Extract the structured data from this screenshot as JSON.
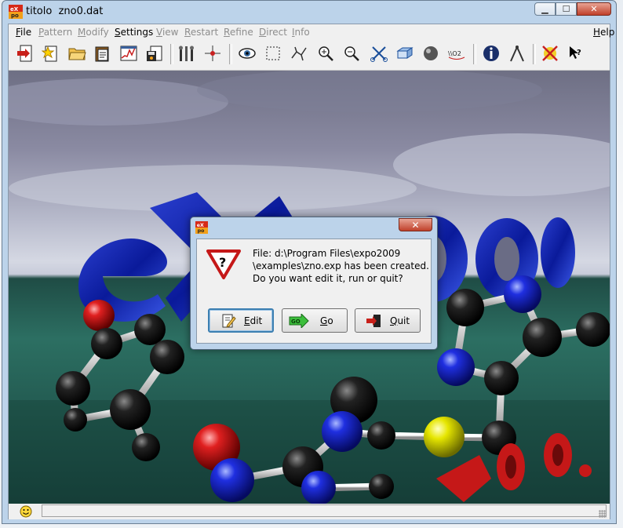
{
  "window": {
    "title": "titolo  zno0.dat",
    "controls": {
      "minimize": "▁",
      "maximize": "☐",
      "close": "✕"
    }
  },
  "menu": [
    {
      "label": "File",
      "enabled": true
    },
    {
      "label": "Pattern",
      "enabled": false
    },
    {
      "label": "Modify",
      "enabled": false
    },
    {
      "label": "Settings",
      "enabled": true
    },
    {
      "label": "View",
      "enabled": false
    },
    {
      "label": "Restart",
      "enabled": false
    },
    {
      "label": "Refine",
      "enabled": false
    },
    {
      "label": "Direct",
      "enabled": false
    },
    {
      "label": "Info",
      "enabled": false
    },
    {
      "label": "Help",
      "enabled": true
    }
  ],
  "toolbar": [
    {
      "icon": "open-file-icon"
    },
    {
      "icon": "new-file-icon"
    },
    {
      "icon": "folder-icon"
    },
    {
      "icon": "clipboard-icon"
    },
    {
      "icon": "pattern-chart-icon"
    },
    {
      "icon": "save-disk-icon"
    },
    {
      "icon": "tools-icon"
    },
    {
      "icon": "crosshair-icon"
    },
    {
      "icon": "eye-icon"
    },
    {
      "icon": "selection-icon"
    },
    {
      "icon": "molecule-icon"
    },
    {
      "icon": "zoom-in-icon"
    },
    {
      "icon": "zoom-out-icon"
    },
    {
      "icon": "scissors-icon"
    },
    {
      "icon": "cell-icon"
    },
    {
      "icon": "sphere-icon"
    },
    {
      "icon": "label-icon",
      "text": "\\\\O2"
    },
    {
      "icon": "info-icon"
    },
    {
      "icon": "compass-icon"
    },
    {
      "icon": "stop-icon"
    },
    {
      "icon": "whats-this-icon"
    }
  ],
  "dialog": {
    "message_lines": [
      "File: d:\\Program Files\\expo2009",
      "\\examples\\zno.exp has been created.",
      "Do you want edit it, run or quit?"
    ],
    "buttons": {
      "edit": "Edit",
      "go": "Go",
      "go_icon_text": "GO",
      "quit": "Quit"
    },
    "close_label": "✕"
  },
  "status": {
    "text": ""
  },
  "colors": {
    "frame": "#bcd3ea",
    "close_red": "#c0402a",
    "molecule_blue": "#1f2fe0",
    "oxygen_red": "#e02020",
    "sulfur_yellow": "#e6e600"
  }
}
